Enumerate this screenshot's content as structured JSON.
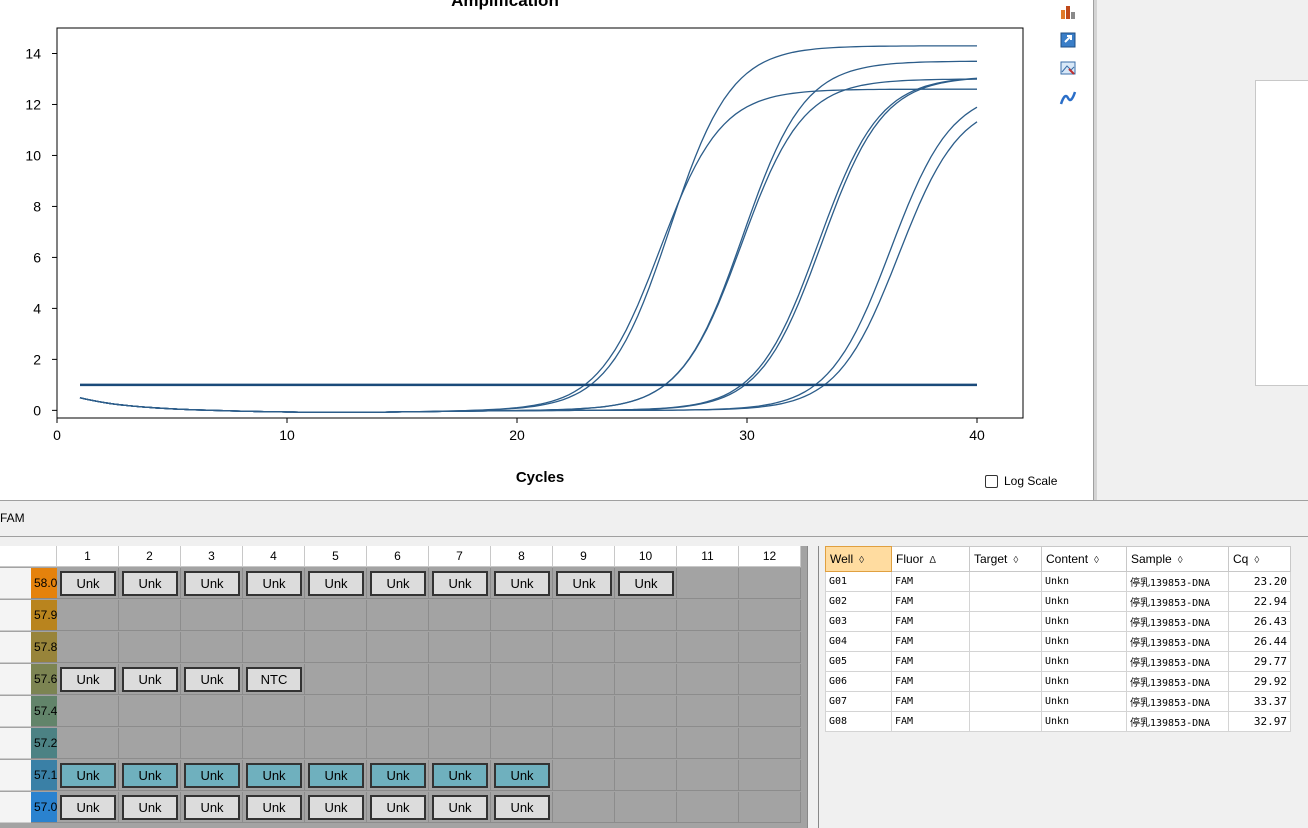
{
  "chart_data": {
    "type": "line",
    "title": "Amplification",
    "xlabel": "Cycles",
    "ylabel": "",
    "xlim": [
      0,
      42
    ],
    "ylim": [
      -0.3,
      15
    ],
    "xticks": [
      0,
      10,
      20,
      30,
      40
    ],
    "yticks": [
      0,
      2,
      4,
      6,
      8,
      10,
      12,
      14
    ],
    "grid": true,
    "threshold": 1.0,
    "line_color": "#2c5d8a",
    "threshold_color": "#1a4a7a",
    "series": [
      {
        "cq": 23.2,
        "plateau": 14.3
      },
      {
        "cq": 22.94,
        "plateau": 12.6
      },
      {
        "cq": 26.43,
        "plateau": 13.7
      },
      {
        "cq": 26.44,
        "plateau": 13.0
      },
      {
        "cq": 29.77,
        "plateau": 13.1
      },
      {
        "cq": 29.92,
        "plateau": 13.1
      },
      {
        "cq": 33.37,
        "plateau": 12.2
      },
      {
        "cq": 32.97,
        "plateau": 12.6
      }
    ]
  },
  "log_scale_label": "Log Scale",
  "fluor_label": "FAM",
  "plate": {
    "columns": [
      "1",
      "2",
      "3",
      "4",
      "5",
      "6",
      "7",
      "8",
      "9",
      "10",
      "11",
      "12"
    ],
    "rows": [
      {
        "temp": "58.0",
        "color": "#e5820c",
        "wells": [
          "Unk",
          "Unk",
          "Unk",
          "Unk",
          "Unk",
          "Unk",
          "Unk",
          "Unk",
          "Unk",
          "Unk",
          "",
          ""
        ],
        "style": "gray"
      },
      {
        "temp": "57.9",
        "color": "#b9841e",
        "wells": [
          "",
          "",
          "",
          "",
          "",
          "",
          "",
          "",
          "",
          "",
          "",
          ""
        ],
        "style": "gray"
      },
      {
        "temp": "57.8",
        "color": "#98843a",
        "wells": [
          "",
          "",
          "",
          "",
          "",
          "",
          "",
          "",
          "",
          "",
          "",
          ""
        ],
        "style": "gray"
      },
      {
        "temp": "57.6",
        "color": "#7c8452",
        "wells": [
          "Unk",
          "Unk",
          "Unk",
          "NTC",
          "",
          "",
          "",
          "",
          "",
          "",
          "",
          ""
        ],
        "style": "gray"
      },
      {
        "temp": "57.4",
        "color": "#62846a",
        "wells": [
          "",
          "",
          "",
          "",
          "",
          "",
          "",
          "",
          "",
          "",
          "",
          ""
        ],
        "style": "gray"
      },
      {
        "temp": "57.2",
        "color": "#4c8284",
        "wells": [
          "",
          "",
          "",
          "",
          "",
          "",
          "",
          "",
          "",
          "",
          "",
          ""
        ],
        "style": "gray"
      },
      {
        "temp": "57.1",
        "color": "#3a80a6",
        "wells": [
          "Unk",
          "Unk",
          "Unk",
          "Unk",
          "Unk",
          "Unk",
          "Unk",
          "Unk",
          "",
          "",
          "",
          ""
        ],
        "style": "blue"
      },
      {
        "temp": "57.0",
        "color": "#2a82cf",
        "wells": [
          "Unk",
          "Unk",
          "Unk",
          "Unk",
          "Unk",
          "Unk",
          "Unk",
          "Unk",
          "",
          "",
          "",
          ""
        ],
        "style": "gray"
      }
    ]
  },
  "table": {
    "headers": [
      "Well",
      "Fluor",
      "Target",
      "Content",
      "Sample",
      "Cq"
    ],
    "sort_glyphs": [
      "◊",
      "Δ",
      "◊",
      "◊",
      "◊",
      "◊"
    ],
    "rows": [
      [
        "G01",
        "FAM",
        "",
        "Unkn",
        "停乳139853-DNA",
        "23.20"
      ],
      [
        "G02",
        "FAM",
        "",
        "Unkn",
        "停乳139853-DNA",
        "22.94"
      ],
      [
        "G03",
        "FAM",
        "",
        "Unkn",
        "停乳139853-DNA",
        "26.43"
      ],
      [
        "G04",
        "FAM",
        "",
        "Unkn",
        "停乳139853-DNA",
        "26.44"
      ],
      [
        "G05",
        "FAM",
        "",
        "Unkn",
        "停乳139853-DNA",
        "29.77"
      ],
      [
        "G06",
        "FAM",
        "",
        "Unkn",
        "停乳139853-DNA",
        "29.92"
      ],
      [
        "G07",
        "FAM",
        "",
        "Unkn",
        "停乳139853-DNA",
        "33.37"
      ],
      [
        "G08",
        "FAM",
        "",
        "Unkn",
        "停乳139853-DNA",
        "32.97"
      ]
    ]
  },
  "toolbar_icons": [
    "chart-type-icon",
    "export-icon",
    "image-icon",
    "curve-icon"
  ]
}
